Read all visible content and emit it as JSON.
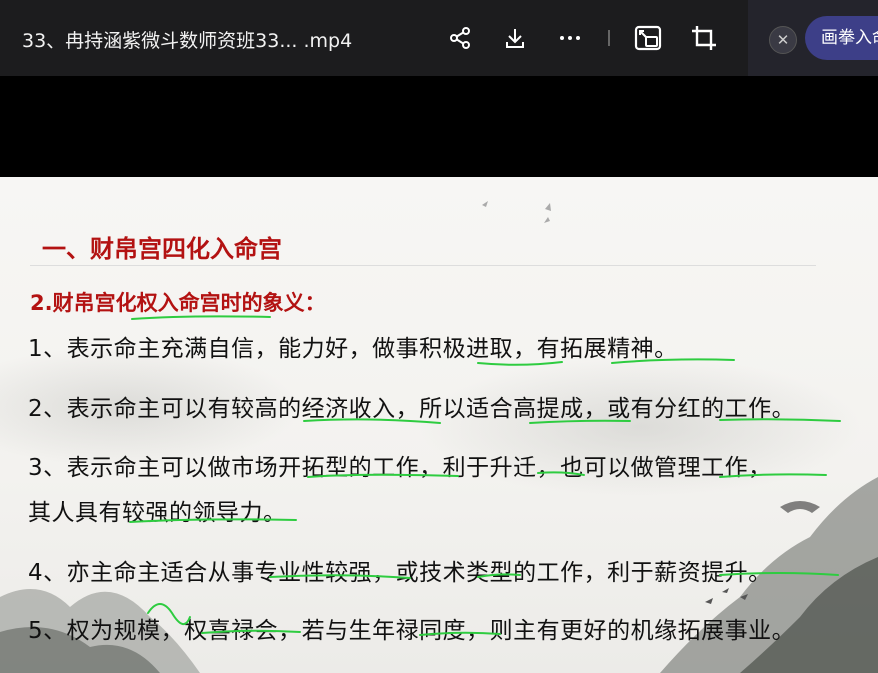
{
  "player": {
    "title": "33、冉持涵紫微斗数师资班33... .mp4",
    "tools": [
      "share-icon",
      "download-icon",
      "more-icon",
      "pip-icon",
      "crop-icon"
    ],
    "close_label": "✕",
    "pip_label": "画拳入命"
  },
  "slide": {
    "heading": "一、财帛宫四化入命宫",
    "subheading": "2.财帛宫化权入命宫时的象义：",
    "lines": [
      "1、表示命主充满自信，能力好，做事积极进取，有拓展精神。",
      "2、表示命主可以有较高的经济收入，所以适合高提成，或有分红的工作。",
      "3、表示命主可以做市场开拓型的工作，利于升迁，也可以做管理工作，",
      "其人具有较强的领导力。",
      "4、亦主命主适合从事专业性较强，或技术类型的工作，利于薪资提升。",
      "5、权为规模，权喜禄会，若与生年禄同度，则主有更好的机缘拓展事业。"
    ]
  },
  "colors": {
    "accent_red": "#b31212",
    "annotation_green": "#2ecc40",
    "pip_button": "#3d3f88"
  }
}
